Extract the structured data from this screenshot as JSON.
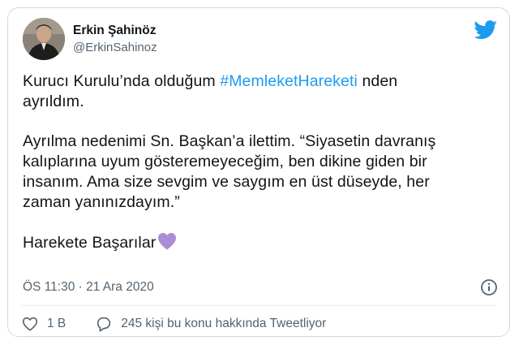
{
  "author": {
    "name": "Erkin Şahinöz",
    "handle": "@ErkinSahinoz",
    "avatar_icon": "profile-photo"
  },
  "brand": {
    "icon": "twitter-bird-icon",
    "color": "#1d9bf0"
  },
  "tweet": {
    "line1_before": "Kurucı Kurulu’nda olduğum ",
    "hashtag": "#MemleketHareketi",
    "line1_after": " nden",
    "line2": "ayrıldım.",
    "para2_l1": "Ayrılma nedenimi Sn. Başkan’a ilettim.  “Siyasetin davranış",
    "para2_l2": "kalıplarına uyum gösteremeyeceğim, ben dikine giden bir",
    "para2_l3": "insanım. Ama size sevgim ve saygım en üst düseyde, her",
    "para2_l4": "zaman yanınızdayım.”",
    "closing": "Harekete Başarılar",
    "emoji": "purple-heart"
  },
  "meta": {
    "timestamp": "ÖS 11:30 · 21 Ara 2020",
    "info_icon": "info-icon"
  },
  "actions": {
    "likes": "1 B",
    "like_icon": "heart-icon",
    "reply_icon": "speech-bubble-icon",
    "replies_text": "245 kişi bu konu hakkında Tweetliyor"
  }
}
